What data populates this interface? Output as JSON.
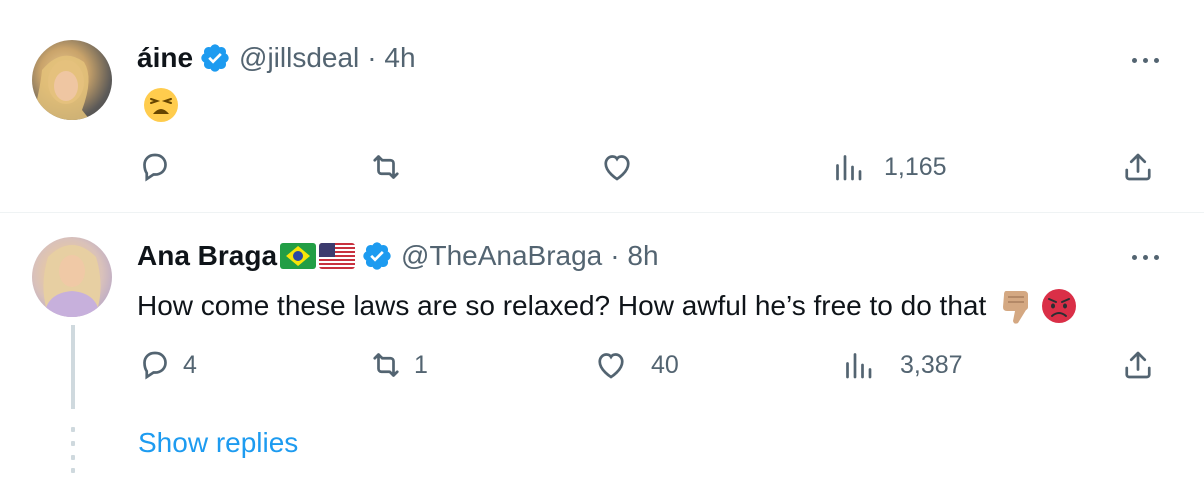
{
  "tweets": [
    {
      "display_name": "áine",
      "handle": "@jillsdeal",
      "time": "· 4h",
      "verified": true,
      "text": "",
      "emojis": [
        "tired-face-emoji"
      ],
      "actions": {
        "reply_count": "",
        "retweet_count": "",
        "like_count": "",
        "view_count": "1,165"
      }
    },
    {
      "display_name": "Ana Braga",
      "flags": [
        "brazil-flag-icon",
        "us-flag-icon"
      ],
      "handle": "@TheAnaBraga",
      "time": "· 8h",
      "verified": true,
      "text": "How come these laws are so relaxed? How awful he’s free to do that",
      "emojis": [
        "thumbs-down-emoji",
        "angry-face-emoji"
      ],
      "actions": {
        "reply_count": "4",
        "retweet_count": "1",
        "like_count": "40",
        "view_count": "3,387"
      }
    }
  ],
  "show_replies_label": "Show replies",
  "colors": {
    "accent": "#1d9bf0",
    "secondary_text": "#536471",
    "primary_text": "#0f1419",
    "border": "#eff3f4"
  }
}
